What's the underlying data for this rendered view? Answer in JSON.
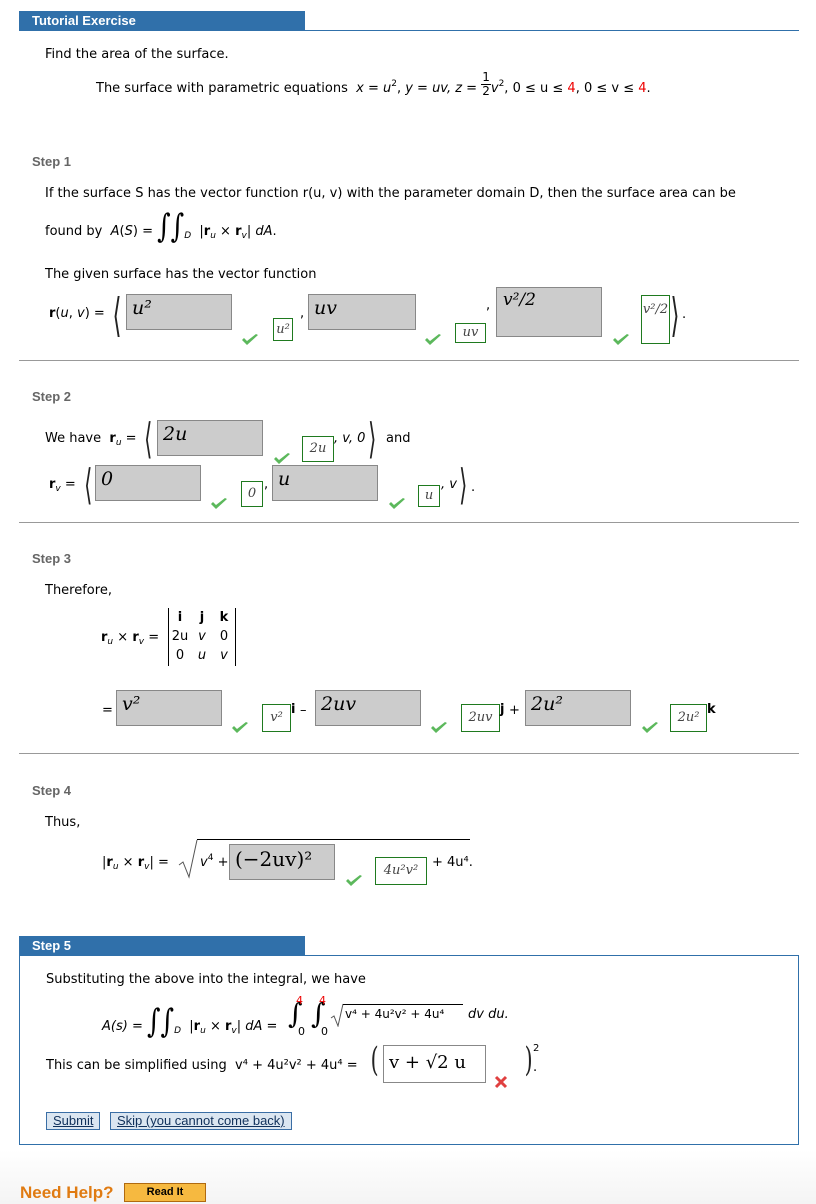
{
  "header": {
    "title": "Tutorial Exercise"
  },
  "problem": {
    "prompt": "Find the area of the surface.",
    "statement_prefix": "The surface with parametric equations",
    "x_eq": "x = u",
    "y_eq": "y = uv,",
    "z_eq": "z =",
    "frac_num": "1",
    "frac_den": "2",
    "z_tail": "v",
    "u_range_prefix": "0 ≤ u ≤",
    "u_max": "4",
    "v_range_prefix": "0 ≤ v ≤",
    "v_max": "4"
  },
  "step1": {
    "label": "Step 1",
    "text1": "If the surface S has the vector function r(u, v) with the parameter domain D, then the surface area can be",
    "text2_prefix": "found by",
    "formula": "A(S) = ∬_D |r_u × r_v| dA.",
    "text3": "The given surface has the vector function",
    "lhs": "r(u, v) =",
    "inputs": [
      {
        "value": "u²",
        "correct_answer": "u²",
        "status": "correct"
      },
      {
        "value": "uv",
        "correct_answer": "uv",
        "status": "correct"
      },
      {
        "value": "v²/2",
        "correct_answer": "v²/2",
        "status": "correct"
      }
    ]
  },
  "step2": {
    "label": "Step 2",
    "ru_prefix": "We have",
    "ru_lhs": "r_u =",
    "ru_tail": ", v, 0",
    "and": "and",
    "rv_lhs": "r_v =",
    "rv_tail": ", v",
    "inputs": [
      {
        "value": "2u",
        "correct_answer": "2u",
        "status": "correct"
      },
      {
        "value": "0",
        "correct_answer": "0",
        "status": "correct"
      },
      {
        "value": "u",
        "correct_answer": "u",
        "status": "correct"
      }
    ]
  },
  "step3": {
    "label": "Step 3",
    "intro": "Therefore,",
    "lhs": "r_u × r_v =",
    "matrix": [
      [
        "i",
        "j",
        "k"
      ],
      [
        "2u",
        "v",
        "0"
      ],
      [
        "0",
        "u",
        "v"
      ]
    ],
    "inputs": [
      {
        "value": "v²",
        "correct_answer": "v²",
        "unit": "i",
        "status": "correct"
      },
      {
        "value": "2uv",
        "correct_answer": "2uv",
        "unit": "j",
        "status": "correct"
      },
      {
        "value": "2u²",
        "correct_answer": "2u²",
        "unit": "k",
        "status": "correct"
      }
    ]
  },
  "step4": {
    "label": "Step 4",
    "intro": "Thus,",
    "lhs": "|r_u × r_v| =",
    "v4": "v⁴ +",
    "tail": "+ 4u⁴.",
    "inputs": [
      {
        "value": "(−2uv)²",
        "correct_answer": "4u²v²",
        "status": "correct"
      }
    ]
  },
  "step5": {
    "label": "Step 5",
    "intro": "Substituting the above into the integral, we have",
    "formula_lhs": "A(s) =",
    "integrand": "|r_u × r_v| dA =",
    "upper1": "4",
    "upper2": "4",
    "lower1": "0",
    "lower2": "0",
    "radicand": "v⁴ + 4u²v² + 4u⁴",
    "tail": "dv du.",
    "simplify_prefix": "This can be simplified using",
    "simplify_expr": "v⁴ + 4u²v² + 4u⁴ =",
    "input": {
      "value": "v + √2 u",
      "status": "incorrect"
    },
    "exponent": "2"
  },
  "buttons": {
    "submit": "Submit",
    "skip": "Skip (you cannot come back)"
  },
  "help": {
    "label": "Need Help?",
    "read_it": "Read It"
  },
  "colors": {
    "header": "#3070aa",
    "correct": "#1f7a1f",
    "incorrect": "#e04040",
    "highlight": "#ee0000",
    "help": "#e07b12"
  }
}
